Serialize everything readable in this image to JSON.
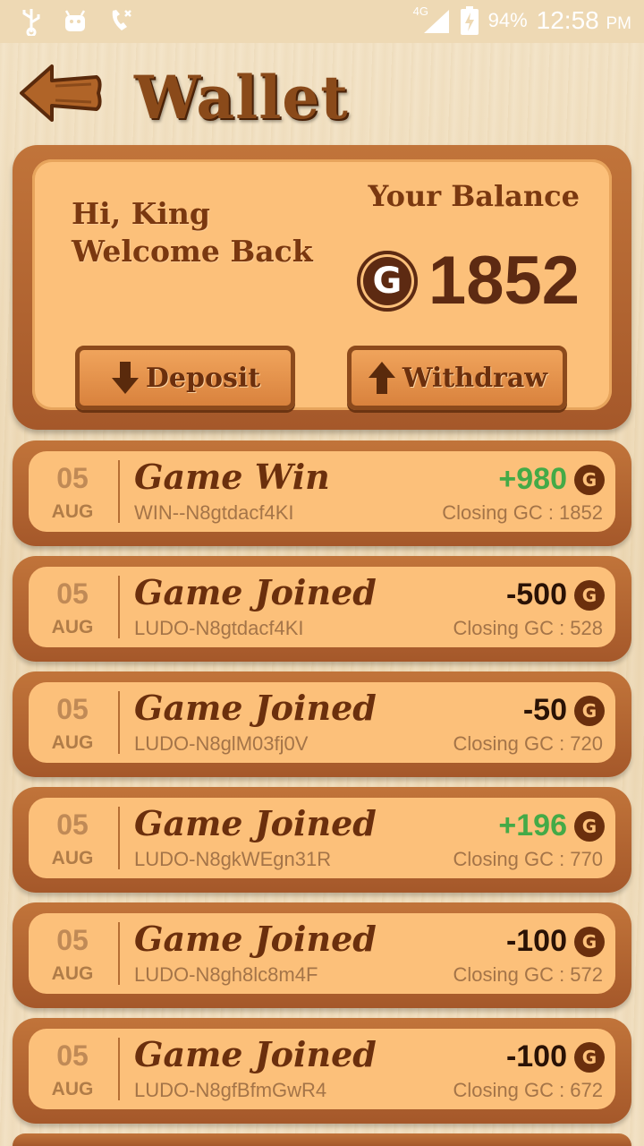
{
  "status_bar": {
    "network": "4G",
    "battery": "94%",
    "time": "12:58",
    "ampm": "PM",
    "icons": [
      "usb-icon",
      "android-icon",
      "missed-call-icon",
      "signal-icon",
      "battery-charging-icon"
    ]
  },
  "header": {
    "title": "Wallet",
    "back_icon": "wooden-back-arrow-icon"
  },
  "balance_card": {
    "greeting_line1": "Hi, King",
    "greeting_line2": "Welcome Back",
    "balance_label": "Your Balance",
    "coin_symbol": "G",
    "balance_value": "1852",
    "deposit_label": "Deposit",
    "withdraw_label": "Withdraw"
  },
  "colors": {
    "positive": "#44aa47",
    "negative": "#2a1205",
    "brand_brown": "#6b2f0d",
    "card_fill": "#fcc07a"
  },
  "transactions": [
    {
      "day": "05",
      "month": "AUG",
      "title": "Game Win",
      "ref": "WIN--N8gtdacf4KI",
      "amount": "+980",
      "positive": true,
      "closing": "Closing GC : 1852"
    },
    {
      "day": "05",
      "month": "AUG",
      "title": "Game Joined",
      "ref": "LUDO-N8gtdacf4KI",
      "amount": "-500",
      "positive": false,
      "closing": "Closing GC : 528"
    },
    {
      "day": "05",
      "month": "AUG",
      "title": "Game Joined",
      "ref": "LUDO-N8glM03fj0V",
      "amount": "-50",
      "positive": false,
      "closing": "Closing GC : 720"
    },
    {
      "day": "05",
      "month": "AUG",
      "title": "Game Joined",
      "ref": "LUDO-N8gkWEgn31R",
      "amount": "+196",
      "positive": true,
      "closing": "Closing GC : 770"
    },
    {
      "day": "05",
      "month": "AUG",
      "title": "Game Joined",
      "ref": "LUDO-N8gh8lc8m4F",
      "amount": "-100",
      "positive": false,
      "closing": "Closing GC : 572"
    },
    {
      "day": "05",
      "month": "AUG",
      "title": "Game Joined",
      "ref": "LUDO-N8gfBfmGwR4",
      "amount": "-100",
      "positive": false,
      "closing": "Closing GC : 672"
    }
  ]
}
